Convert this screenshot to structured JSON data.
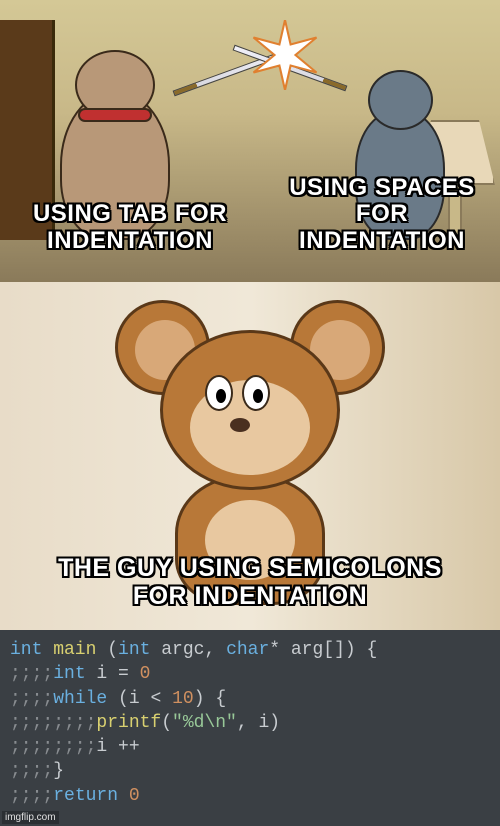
{
  "captions": {
    "left": "USING TAB FOR INDENTATION",
    "right": "USING SPACES FOR INDENTATION",
    "bottom": "THE GUY USING SEMICOLONS FOR INDENTATION"
  },
  "code": {
    "l0": {
      "pre": "",
      "t0": "int",
      "t1": " main ",
      "p0": "(",
      "t2": "int",
      "t3": " argc",
      "c0": ", ",
      "t4": "char",
      "t5": "* arg",
      "p1": "[])",
      "b0": " {"
    },
    "l1": {
      "semi": ";;;;",
      "t0": "int",
      "t1": " i ",
      "op": "=",
      "sp": " ",
      "n": "0"
    },
    "l2": {
      "semi": ";;;;",
      "t0": "while",
      "sp0": " ",
      "p0": "(",
      "v": "i ",
      "op": "<",
      "sp1": " ",
      "n": "10",
      "p1": ")",
      "sp2": " ",
      "b0": "{"
    },
    "l3": {
      "semi": ";;;;;;;;",
      "fn": "printf",
      "p0": "(",
      "s": "\"%d\\n\"",
      "c0": ", ",
      "v": "i",
      "p1": ")"
    },
    "l4": {
      "semi": ";;;;;;;;",
      "v": "i ",
      "op": "++"
    },
    "l5": {
      "semi": ";;;;",
      "b": "}"
    },
    "l6": {
      "semi": ";;;;",
      "t0": "return",
      "sp": " ",
      "n": "0"
    }
  },
  "watermark": "imgflip.com"
}
